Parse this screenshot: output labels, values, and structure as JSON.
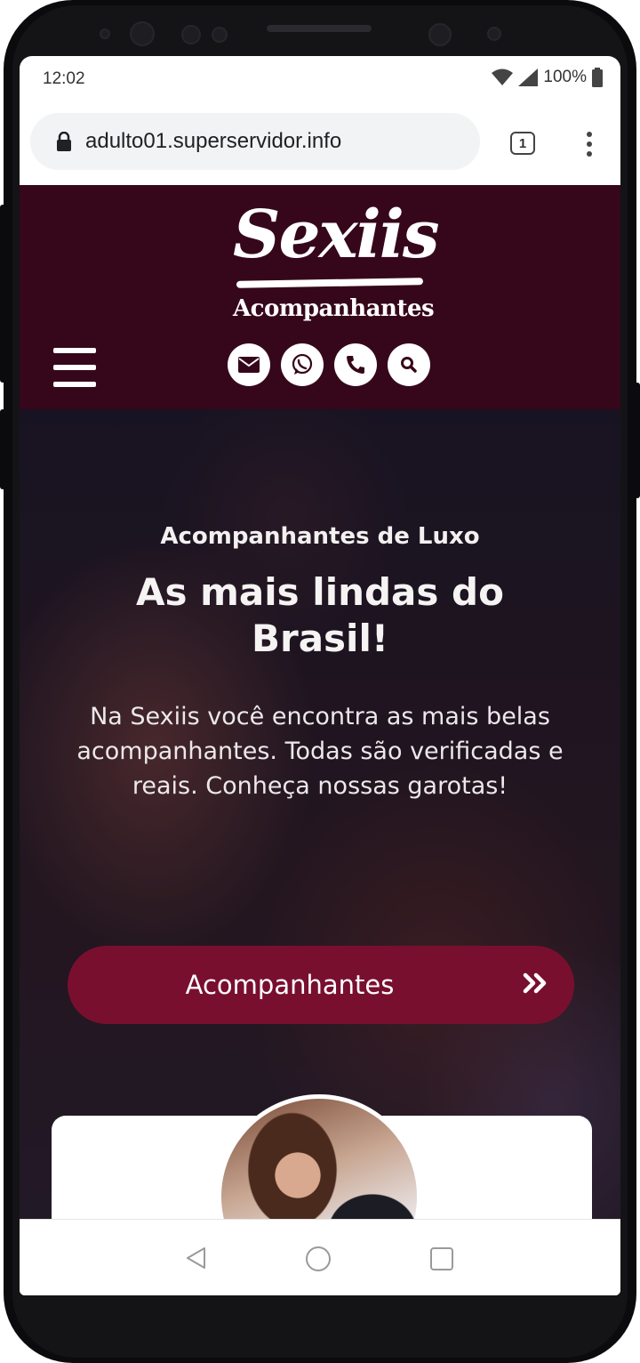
{
  "status_bar": {
    "time": "12:02",
    "battery": "100%"
  },
  "browser": {
    "url": "adulto01.superservidor.info",
    "tab_count": "1"
  },
  "site": {
    "logo_text": "Sexiis",
    "logo_subtitle": "Acompanhantes",
    "header_icons": [
      "envelope-icon",
      "whatsapp-icon",
      "phone-icon",
      "search-icon"
    ]
  },
  "hero": {
    "subtitle": "Acompanhantes de Luxo",
    "title": "As mais lindas do Brasil!",
    "text": "Na Sexiis você encontra as mais belas acompanhantes. Todas são verificadas e reais. Conheça nossas garotas!",
    "cta_label": "Acompanhantes"
  },
  "colors": {
    "header_bg": "#36071a",
    "cta_bg": "#790f2e"
  }
}
